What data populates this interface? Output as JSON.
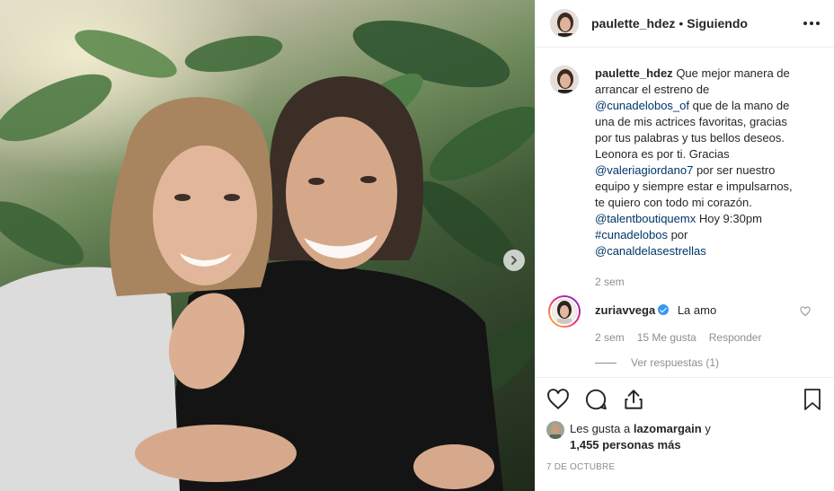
{
  "post": {
    "author": "paulette_hdez",
    "separator": "•",
    "follow_status": "Siguiendo",
    "caption": {
      "parts": [
        {
          "type": "text",
          "value": "Que mejor manera de arrancar el estreno de "
        },
        {
          "type": "mention",
          "value": "@cunadelobos_of"
        },
        {
          "type": "text",
          "value": " que de la mano de una de mis actrices favoritas, gracias por tus palabras y tus bellos deseos. Leonora es por ti. Gracias "
        },
        {
          "type": "mention",
          "value": "@valeriagiordano7"
        },
        {
          "type": "text",
          "value": " por ser nuestro equipo y siempre estar e impulsarnos, te quiero con todo mi corazón. "
        },
        {
          "type": "mention",
          "value": "@talentboutiquemx"
        },
        {
          "type": "text",
          "value": " Hoy 9:30pm "
        },
        {
          "type": "mention",
          "value": "#cunadelobos"
        },
        {
          "type": "text",
          "value": " por "
        },
        {
          "type": "mention",
          "value": "@canaldelasestrellas"
        }
      ],
      "time": "2 sem"
    },
    "comment": {
      "user": "zuriavvega",
      "verified": true,
      "text": "La amo",
      "time": "2 sem",
      "likes": "15 Me gusta",
      "reply_label": "Responder",
      "view_replies": "Ver respuestas (1)"
    },
    "likes": {
      "prefix": "Les gusta a",
      "first_user": "lazomargain",
      "conjunction": "y",
      "others": "1,455 personas más"
    },
    "date": "7 DE OCTUBRE"
  },
  "icons": [
    "more-icon",
    "next-arrow-icon",
    "heart-icon",
    "comment-icon",
    "share-icon",
    "bookmark-icon",
    "verified-icon"
  ],
  "colors": {
    "mention": "#003569",
    "muted": "#8e8e8e",
    "verified": "#3897f0",
    "text": "#262626"
  }
}
